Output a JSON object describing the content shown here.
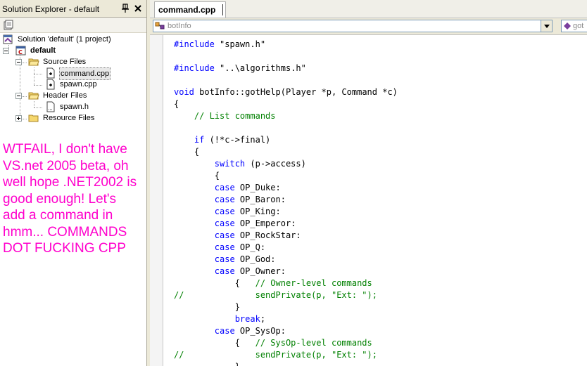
{
  "solution_explorer": {
    "title": "Solution Explorer - default",
    "pin_icon": "pushpin-icon",
    "close_icon": "close-icon",
    "tree": {
      "solution": "Solution 'default' (1 project)",
      "project": "default",
      "source_files": "Source Files",
      "source_items": [
        "command.cpp",
        "spawn.cpp"
      ],
      "header_files": "Header Files",
      "header_items": [
        "spawn.h"
      ],
      "resource_files": "Resource Files"
    }
  },
  "annotation": {
    "lines": [
      "WTFAIL, I don't have",
      "VS.net 2005 beta, oh",
      "well hope .NET2002 is",
      "good enough! Let's",
      "add a command in",
      "hmm... COMMANDS",
      "DOT FUCKING CPP"
    ],
    "color": "#ff00cc"
  },
  "editor": {
    "active_tab": "command.cpp",
    "class_combo": "botInfo",
    "member_combo": "got",
    "code_lines": [
      [
        {
          "t": "#include",
          "c": "kw"
        },
        {
          "t": " \"spawn.h\""
        }
      ],
      [],
      [
        {
          "t": "#include",
          "c": "kw"
        },
        {
          "t": " \"..\\algorithms.h\""
        }
      ],
      [],
      [
        {
          "t": "void",
          "c": "kw"
        },
        {
          "t": " botInfo::gotHelp(Player *p, Command *c)"
        }
      ],
      [
        {
          "t": "{"
        }
      ],
      [
        {
          "t": "    "
        },
        {
          "t": "// List commands",
          "c": "cm"
        }
      ],
      [],
      [
        {
          "t": "    "
        },
        {
          "t": "if",
          "c": "kw"
        },
        {
          "t": " (!*c->final)"
        }
      ],
      [
        {
          "t": "    {"
        }
      ],
      [
        {
          "t": "        "
        },
        {
          "t": "switch",
          "c": "kw"
        },
        {
          "t": " (p->access)"
        }
      ],
      [
        {
          "t": "        {"
        }
      ],
      [
        {
          "t": "        "
        },
        {
          "t": "case",
          "c": "kw"
        },
        {
          "t": " OP_Duke:"
        }
      ],
      [
        {
          "t": "        "
        },
        {
          "t": "case",
          "c": "kw"
        },
        {
          "t": " OP_Baron:"
        }
      ],
      [
        {
          "t": "        "
        },
        {
          "t": "case",
          "c": "kw"
        },
        {
          "t": " OP_King:"
        }
      ],
      [
        {
          "t": "        "
        },
        {
          "t": "case",
          "c": "kw"
        },
        {
          "t": " OP_Emperor:"
        }
      ],
      [
        {
          "t": "        "
        },
        {
          "t": "case",
          "c": "kw"
        },
        {
          "t": " OP_RockStar:"
        }
      ],
      [
        {
          "t": "        "
        },
        {
          "t": "case",
          "c": "kw"
        },
        {
          "t": " OP_Q:"
        }
      ],
      [
        {
          "t": "        "
        },
        {
          "t": "case",
          "c": "kw"
        },
        {
          "t": " OP_God:"
        }
      ],
      [
        {
          "t": "        "
        },
        {
          "t": "case",
          "c": "kw"
        },
        {
          "t": " OP_Owner:"
        }
      ],
      [
        {
          "t": "            {   "
        },
        {
          "t": "// Owner-level commands",
          "c": "cm"
        }
      ],
      [
        {
          "t": "//              sendPrivate(p, \"Ext: \");",
          "c": "cm"
        }
      ],
      [
        {
          "t": "            }"
        }
      ],
      [
        {
          "t": "            "
        },
        {
          "t": "break",
          "c": "kw"
        },
        {
          "t": ";"
        }
      ],
      [
        {
          "t": "        "
        },
        {
          "t": "case",
          "c": "kw"
        },
        {
          "t": " OP_SysOp:"
        }
      ],
      [
        {
          "t": "            {   "
        },
        {
          "t": "// SysOp-level commands",
          "c": "cm"
        }
      ],
      [
        {
          "t": "//              sendPrivate(p, \"Ext: \");",
          "c": "cm"
        }
      ],
      [
        {
          "t": "            }"
        }
      ]
    ]
  }
}
